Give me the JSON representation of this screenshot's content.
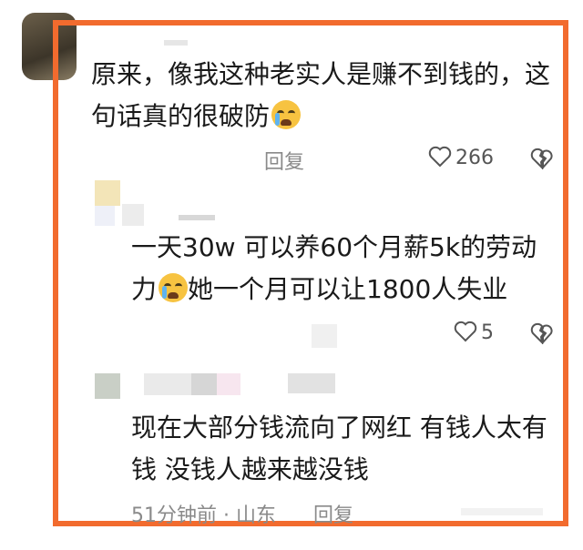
{
  "comments": [
    {
      "text_line1": "原来，像我这种老实人是赚不到钱的，这",
      "text_line2": "句话真的很破防",
      "reply_label": "回复",
      "like_count": "266"
    },
    {
      "text_line1": "一天30w  可以养60个月薪5k的劳动",
      "text_line2_a": "力",
      "text_line2_b": "她一个月可以让1800人失业",
      "like_count": "5"
    },
    {
      "text_line1": "现在大部分钱流向了网红 有钱人太有",
      "text_line2": "钱 没钱人越来越没钱",
      "time": "51分钟前",
      "separator": "·",
      "location": "山东",
      "reply_label": "回复"
    }
  ],
  "colors": {
    "frame": "#f26b2e",
    "text": "#1a1a1a",
    "meta": "#8a8a8a"
  },
  "icons": [
    "heart-outline-icon",
    "broken-heart-icon",
    "crying-emoji-icon"
  ]
}
